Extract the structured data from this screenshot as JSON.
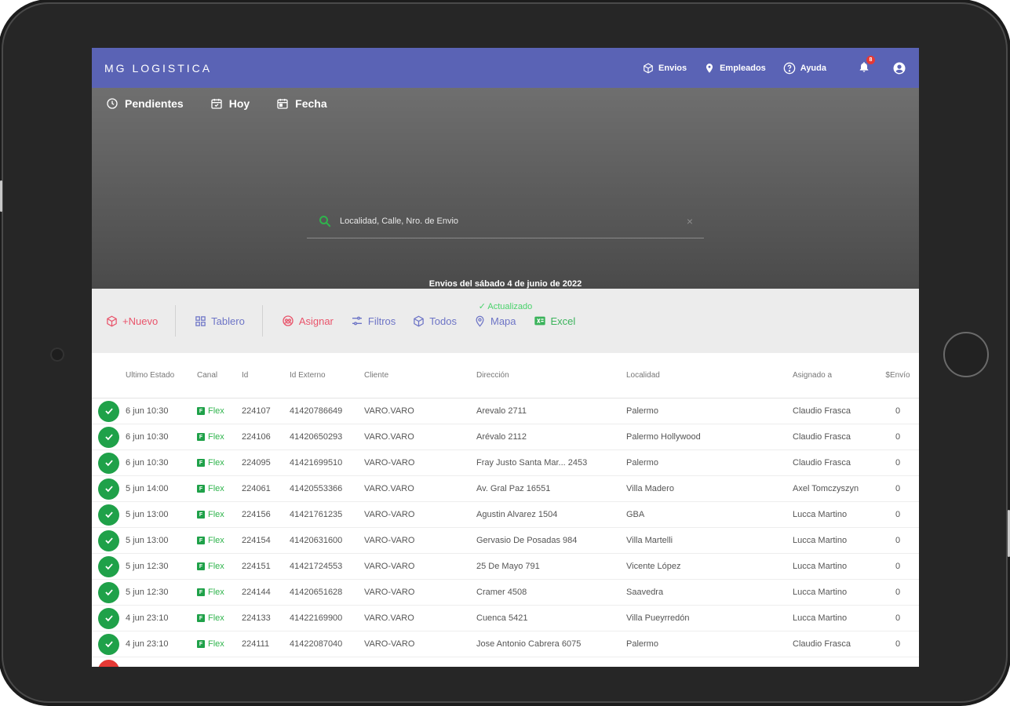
{
  "app": {
    "brand": "MG LOGISTICA",
    "nav": [
      {
        "label": "Envios",
        "icon": "cube-icon"
      },
      {
        "label": "Empleados",
        "icon": "location-pin-icon"
      },
      {
        "label": "Ayuda",
        "icon": "help-icon"
      }
    ],
    "notifications_count": "8",
    "colors": {
      "header": "#5a63b5",
      "success": "#1fa149",
      "danger": "#e53935"
    }
  },
  "tabs": [
    {
      "label": "Pendientes",
      "icon": "clock-icon"
    },
    {
      "label": "Hoy",
      "icon": "calendar-check-icon"
    },
    {
      "label": "Fecha",
      "icon": "calendar-icon"
    }
  ],
  "search": {
    "placeholder": "Localidad, Calle, Nro. de Envio",
    "clear": "×"
  },
  "status": {
    "date_line": "Envios del sábado 4 de junio de 2022",
    "updated": "✓ Actualizado"
  },
  "actions": [
    {
      "label": "+Nuevo",
      "icon": "box-icon",
      "color": "#e9546b"
    },
    {
      "label": "Tablero",
      "icon": "grid-icon",
      "color": "#6d74c6"
    },
    {
      "label": "Asignar",
      "icon": "assign-icon",
      "color": "#e9546b"
    },
    {
      "label": "Filtros",
      "icon": "sliders-icon",
      "color": "#6d74c6"
    },
    {
      "label": "Todos",
      "icon": "cube-icon",
      "color": "#6d74c6"
    },
    {
      "label": "Mapa",
      "icon": "location-pin-icon",
      "color": "#6d74c6"
    },
    {
      "label": "Excel",
      "icon": "excel-icon",
      "color": "#3bb35b"
    }
  ],
  "table": {
    "headers": [
      "Ultimo Estado",
      "Canal",
      "Id",
      "Id Externo",
      "Cliente",
      "Dirección",
      "Localidad",
      "Asignado a",
      "$Envío"
    ],
    "rows": [
      {
        "estado": "6 jun 10:30",
        "canal": "Flex",
        "id": "224107",
        "ext": "41420786649",
        "cliente": "VARO.VARO",
        "dir": "Arevalo 2711",
        "loc": "Palermo",
        "asig": "Claudio Frasca",
        "envio": "0"
      },
      {
        "estado": "6 jun 10:30",
        "canal": "Flex",
        "id": "224106",
        "ext": "41420650293",
        "cliente": "VARO.VARO",
        "dir": "Arévalo 2112",
        "loc": "Palermo Hollywood",
        "asig": "Claudio Frasca",
        "envio": "0"
      },
      {
        "estado": "6 jun 10:30",
        "canal": "Flex",
        "id": "224095",
        "ext": "41421699510",
        "cliente": "VARO-VARO",
        "dir": "Fray Justo Santa Mar... 2453",
        "loc": "Palermo",
        "asig": "Claudio Frasca",
        "envio": "0"
      },
      {
        "estado": "5 jun 14:00",
        "canal": "Flex",
        "id": "224061",
        "ext": "41420553366",
        "cliente": "VARO.VARO",
        "dir": "Av. Gral Paz 16551",
        "loc": "Villa Madero",
        "asig": "Axel Tomczyszyn",
        "envio": "0"
      },
      {
        "estado": "5 jun 13:00",
        "canal": "Flex",
        "id": "224156",
        "ext": "41421761235",
        "cliente": "VARO-VARO",
        "dir": "Agustin Alvarez 1504",
        "loc": "GBA",
        "asig": "Lucca Martino",
        "envio": "0"
      },
      {
        "estado": "5 jun 13:00",
        "canal": "Flex",
        "id": "224154",
        "ext": "41420631600",
        "cliente": "VARO-VARO",
        "dir": "Gervasio De Posadas 984",
        "loc": "Villa Martelli",
        "asig": "Lucca Martino",
        "envio": "0"
      },
      {
        "estado": "5 jun 12:30",
        "canal": "Flex",
        "id": "224151",
        "ext": "41421724553",
        "cliente": "VARO-VARO",
        "dir": "25 De Mayo 791",
        "loc": "Vicente López",
        "asig": "Lucca Martino",
        "envio": "0"
      },
      {
        "estado": "5 jun 12:30",
        "canal": "Flex",
        "id": "224144",
        "ext": "41420651628",
        "cliente": "VARO-VARO",
        "dir": "Cramer 4508",
        "loc": "Saavedra",
        "asig": "Lucca Martino",
        "envio": "0"
      },
      {
        "estado": "4 jun 23:10",
        "canal": "Flex",
        "id": "224133",
        "ext": "41422169900",
        "cliente": "VARO.VARO",
        "dir": "Cuenca 5421",
        "loc": "Villa Pueyrredón",
        "asig": "Lucca Martino",
        "envio": "0"
      },
      {
        "estado": "4 jun 23:10",
        "canal": "Flex",
        "id": "224111",
        "ext": "41422087040",
        "cliente": "VARO-VARO",
        "dir": "Jose Antonio Cabrera 6075",
        "loc": "Palermo",
        "asig": "Claudio Frasca",
        "envio": "0"
      }
    ]
  }
}
